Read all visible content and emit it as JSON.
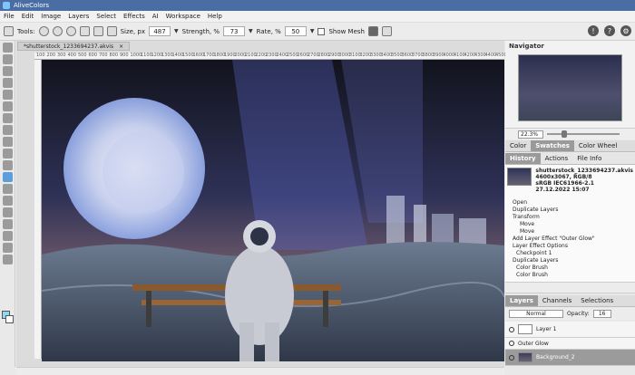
{
  "app": {
    "title": "AliveColors"
  },
  "menu": [
    "File",
    "Edit",
    "Image",
    "Layers",
    "Select",
    "Effects",
    "AI",
    "Workspace",
    "Help"
  ],
  "toolbar": {
    "tools_label": "Tools:",
    "size_label": "Size, px",
    "size_value": "487",
    "strength_label": "Strength, %",
    "strength_value": "73",
    "rate_label": "Rate, %",
    "rate_value": "50",
    "show_mesh_label": "Show Mesh"
  },
  "document": {
    "tab_label": "*shutterstock_1233694237.akvis",
    "close": "×"
  },
  "ruler_ticks": [
    "100",
    "200",
    "300",
    "400",
    "500",
    "600",
    "700",
    "800",
    "900",
    "1000",
    "1100",
    "1200",
    "1300",
    "1400",
    "1500",
    "1600",
    "1700",
    "1800",
    "1900",
    "2000",
    "2100",
    "2200",
    "2300",
    "2400",
    "2500",
    "2600",
    "2700",
    "2800",
    "2900",
    "3000",
    "3100",
    "3200",
    "3300",
    "3400",
    "3500",
    "3600",
    "3700",
    "3800",
    "3900",
    "4000",
    "4100",
    "4200",
    "4300",
    "4400",
    "4500"
  ],
  "navigator": {
    "title": "Navigator",
    "zoom": "22.3%"
  },
  "swatch_tabs": [
    "Color",
    "Swatches",
    "Color Wheel"
  ],
  "history_tabs": [
    "History",
    "Actions",
    "File Info"
  ],
  "file_info": {
    "name": "shutterstock_1233694237.akvis",
    "dims": "4600x3067, RGB/8",
    "profile": "sRGB IEC61966-2.1",
    "date": "27.12.2022 15:07"
  },
  "history": [
    {
      "label": "Open",
      "level": 0
    },
    {
      "label": "Duplicate Layers",
      "level": 0
    },
    {
      "label": "Transform",
      "level": 0
    },
    {
      "label": "Move",
      "level": 2
    },
    {
      "label": "Move",
      "level": 2
    },
    {
      "label": "Add Layer Effect \"Outer Glow\"",
      "level": 0
    },
    {
      "label": "Layer Effect Options",
      "level": 0
    },
    {
      "label": "Checkpoint 1",
      "level": 1
    },
    {
      "label": "Duplicate Layers",
      "level": 0
    },
    {
      "label": "Color Brush",
      "level": 1
    },
    {
      "label": "Color Brush",
      "level": 1
    }
  ],
  "layers_tabs": [
    "Layers",
    "Channels",
    "Selections"
  ],
  "layers": {
    "blend_mode": "Normal",
    "opacity_label": "Opacity:",
    "opacity_value": "16",
    "items": [
      {
        "name": "Layer 1"
      },
      {
        "name": "Outer Glow"
      },
      {
        "name": "Background_2"
      }
    ]
  },
  "colors": {
    "title_bar": "#4a6ea3",
    "active_tab": "#9a9a9a",
    "foreground_swatch": "#8ed8f4"
  }
}
